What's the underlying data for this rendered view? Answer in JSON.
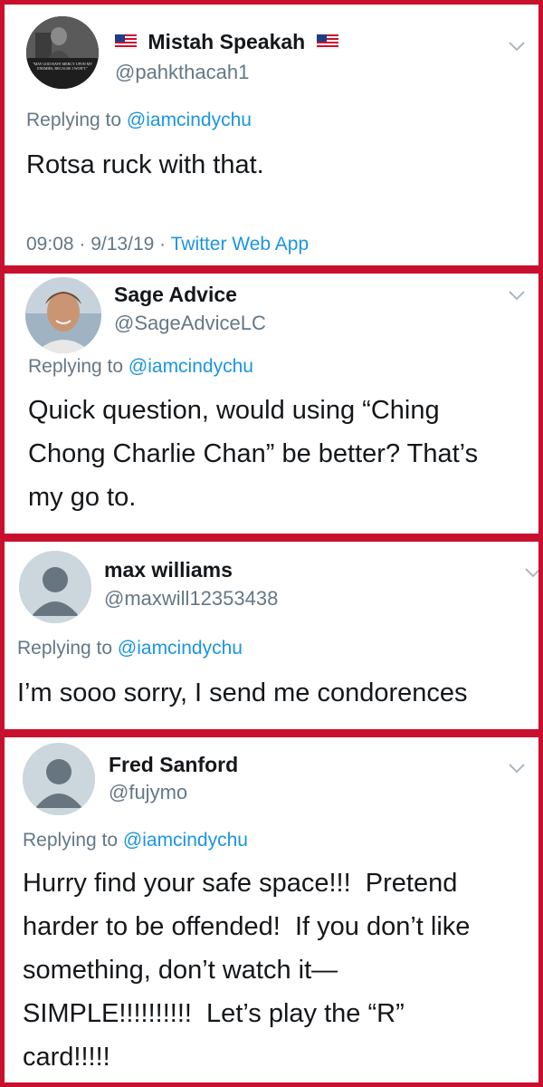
{
  "tweets": [
    {
      "name": "Mistah Speakah",
      "handle": "@pahkthacah1",
      "replying_prefix": "Replying to",
      "replying_to": "@iamcindychu",
      "text": "Rotsa ruck with that.",
      "time": "09:08",
      "sep1": " · ",
      "date": "9/13/19",
      "sep2": " · ",
      "source": "Twitter Web App",
      "avatar_quote": "\"MAY GOD HAVE MERCY UPON MY ENEMIES, BECAUSE I WON'T.\""
    },
    {
      "name": "Sage Advice",
      "handle": "@SageAdviceLC",
      "replying_prefix": "Replying to",
      "replying_to": "@iamcindychu",
      "text": "Quick question, would using “Ching\nChong Charlie Chan” be better? That’s\nmy go to."
    },
    {
      "name": "max williams",
      "handle": "@maxwill12353438",
      "replying_prefix": "Replying to",
      "replying_to": "@iamcindychu",
      "text": "I’m sooo sorry, I send me condorences"
    },
    {
      "name": "Fred Sanford",
      "handle": "@fujymo",
      "replying_prefix": "Replying to",
      "replying_to": "@iamcindychu",
      "text": "Hurry find your safe space!!!  Pretend\nharder to be offended!  If you don’t like\nsomething, don’t watch it—\nSIMPLE!!!!!!!!!!  Let’s play the “R”\ncard!!!!!"
    }
  ],
  "colors": {
    "frame": "#c8102e",
    "link": "#1b95e0",
    "secondary": "#657786",
    "primary": "#14171a",
    "default_avatar": "#ccd6dd"
  }
}
